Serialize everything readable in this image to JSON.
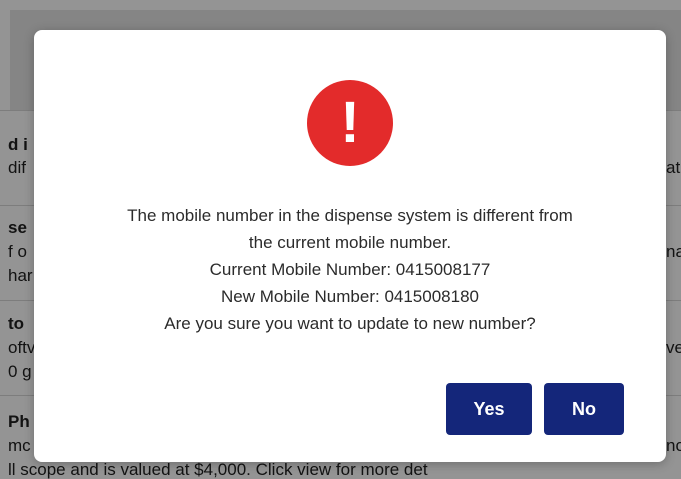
{
  "background": {
    "fragments": [
      "d i",
      "dif",
      "se",
      "f o",
      "har",
      "to",
      "oftv",
      "0 g",
      "Ph",
      "mc",
      "ll scope and is valued at $4,000. Click view for more det",
      "ati",
      "na",
      "ve",
      "nc"
    ]
  },
  "dialog": {
    "icon": "alert-exclamation-icon",
    "icon_glyph": "!",
    "icon_color": "#e32b2b",
    "message_lines": [
      "The mobile number in the dispense system is different from",
      "the current mobile number.",
      "Current Mobile Number: 0415008177",
      "New Mobile Number: 0415008180",
      "Are you sure you want to update to new number?"
    ],
    "yes_label": "Yes",
    "no_label": "No",
    "button_color": "#14267a"
  }
}
